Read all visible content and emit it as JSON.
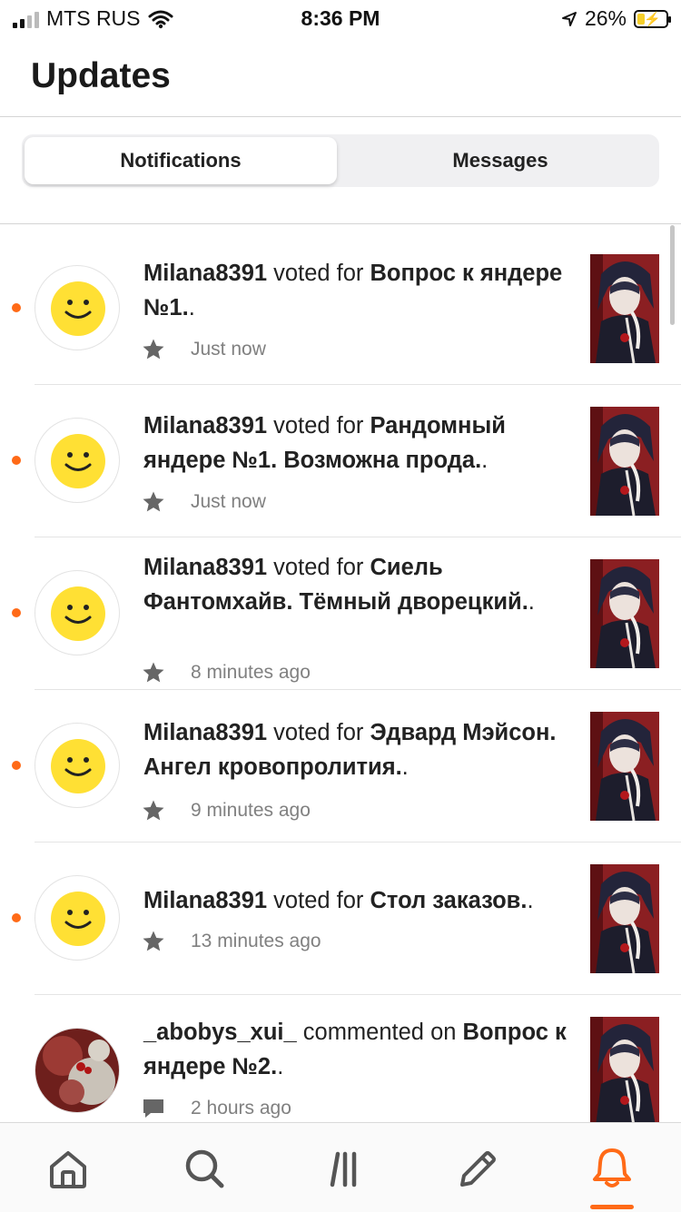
{
  "status_bar": {
    "carrier": "MTS RUS",
    "time": "8:36 PM",
    "battery": "26%",
    "battery_level": 0.26
  },
  "header": {
    "title": "Updates"
  },
  "tabs": {
    "notifications": "Notifications",
    "messages": "Messages",
    "active": "notifications"
  },
  "notifications": [
    {
      "user": "Milana8391",
      "action": " voted for ",
      "story": "Вопрос к яндере №1.",
      "suffix": ".",
      "time": "Just now",
      "icon": "star-icon",
      "unread": true,
      "avatar": "smiley"
    },
    {
      "user": "Milana8391",
      "action": " voted for ",
      "story": "Рандомный яндере №1. Возможна прода.",
      "suffix": ".",
      "time": "Just now",
      "icon": "star-icon",
      "unread": true,
      "avatar": "smiley"
    },
    {
      "user": "Milana8391",
      "action": " voted for ",
      "story": "Сиель Фантомхайв. Тёмный дворецкий.",
      "suffix": ".",
      "time": "8 minutes ago",
      "icon": "star-icon",
      "unread": true,
      "avatar": "smiley"
    },
    {
      "user": "Milana8391",
      "action": " voted for ",
      "story": "Эдвард Мэйсон. Ангел кровопролития.",
      "suffix": ".",
      "time": "9 minutes ago",
      "icon": "star-icon",
      "unread": true,
      "avatar": "smiley"
    },
    {
      "user": "Milana8391",
      "action": " voted for ",
      "story": "Стол заказов.",
      "suffix": ".",
      "time": "13 minutes ago",
      "icon": "star-icon",
      "unread": true,
      "avatar": "smiley"
    },
    {
      "user": "_abobys_xui_",
      "action": " commented on ",
      "story": "Вопрос к яндере №2.",
      "suffix": ".",
      "time": "2 hours ago",
      "icon": "comment-icon",
      "unread": false,
      "avatar": "photo"
    }
  ],
  "bottom_nav": [
    "home-icon",
    "search-icon",
    "library-icon",
    "write-icon",
    "bell-icon"
  ],
  "colors": {
    "accent": "#ff6a17",
    "smiley": "#ffe034"
  }
}
